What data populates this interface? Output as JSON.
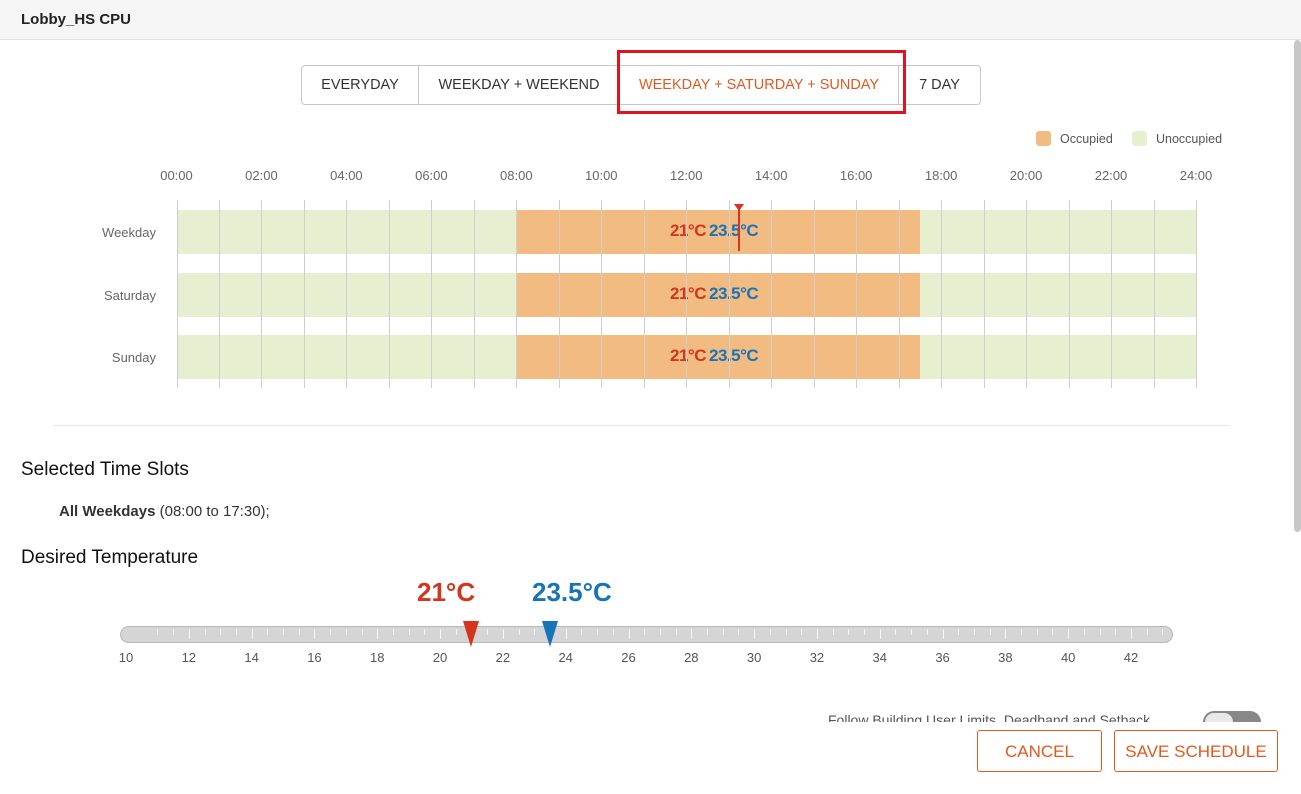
{
  "window": {
    "title": "Lobby_HS CPU"
  },
  "tabs": [
    {
      "label": "EVERYDAY",
      "active": false
    },
    {
      "label": "WEEKDAY + WEEKEND",
      "active": false
    },
    {
      "label": "WEEKDAY + SATURDAY + SUNDAY",
      "active": true
    },
    {
      "label": "7 DAY",
      "active": false
    }
  ],
  "legend": {
    "occupied": {
      "label": "Occupied",
      "color": "#f2bb82"
    },
    "unoccupied": {
      "label": "Unoccupied",
      "color": "#e6f0d1"
    }
  },
  "schedule": {
    "time_labels": [
      "00:00",
      "02:00",
      "04:00",
      "06:00",
      "08:00",
      "10:00",
      "12:00",
      "14:00",
      "16:00",
      "18:00",
      "20:00",
      "22:00",
      "24:00"
    ],
    "current_time_hours": 13.25,
    "rows": [
      {
        "day": "Weekday",
        "occupied_start": "08:00",
        "occupied_end": "17:30",
        "heat": "21°C",
        "cool": "23.5°C"
      },
      {
        "day": "Saturday",
        "occupied_start": "08:00",
        "occupied_end": "17:30",
        "heat": "21°C",
        "cool": "23.5°C"
      },
      {
        "day": "Sunday",
        "occupied_start": "08:00",
        "occupied_end": "17:30",
        "heat": "21°C",
        "cool": "23.5°C"
      }
    ]
  },
  "selected_slots": {
    "heading": "Selected Time Slots",
    "label": "All Weekdays",
    "range": "(08:00 to 17:30);"
  },
  "desired_temperature": {
    "heading": "Desired Temperature",
    "heat_label": "21°C",
    "cool_label": "23.5°C",
    "heat_value": 21,
    "cool_value": 23.5,
    "scale_min": 10,
    "scale_max": 43,
    "scale_labels": [
      "10",
      "12",
      "14",
      "16",
      "18",
      "20",
      "22",
      "24",
      "26",
      "28",
      "30",
      "32",
      "34",
      "36",
      "38",
      "40",
      "42"
    ],
    "heat_color": "#d4351c",
    "cool_color": "#1873b9"
  },
  "follow_limits": {
    "label": "Follow Building User Limits, Deadband and Setback",
    "enabled": false
  },
  "actions": {
    "cancel": "CANCEL",
    "save": "SAVE SCHEDULE"
  },
  "colors": {
    "accent": "#e0591e",
    "highlight": "#e0141e"
  }
}
